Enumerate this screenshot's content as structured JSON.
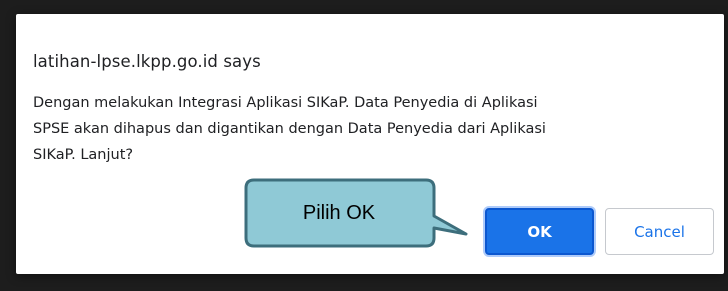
{
  "dialog": {
    "title": "latihan-lpse.lkpp.go.id says",
    "message_lines": [
      "Dengan melakukan Integrasi Aplikasi SIKaP. Data Penyedia di Aplikasi",
      "SPSE akan dihapus dan digantikan dengan Data Penyedia dari Aplikasi",
      "SIKaP. Lanjut?"
    ],
    "ok_label": "OK",
    "cancel_label": "Cancel"
  },
  "callout": {
    "text": "Pilih OK",
    "fill_color": "#8fc9d6",
    "border_color": "#3d6e7c"
  },
  "colors": {
    "primary": "#1a73e8",
    "backdrop": "#1d1d1d"
  }
}
